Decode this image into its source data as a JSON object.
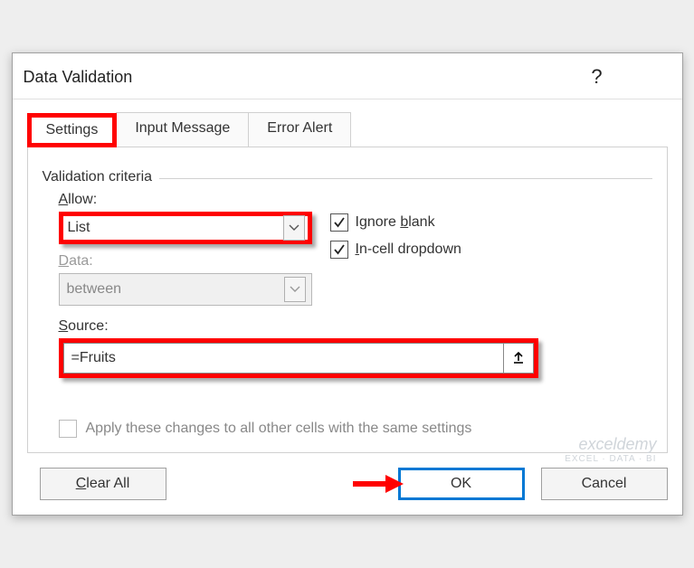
{
  "dialog": {
    "title": "Data Validation"
  },
  "tabs": {
    "settings": "Settings",
    "input_message": "Input Message",
    "error_alert": "Error Alert"
  },
  "criteria": {
    "legend": "Validation criteria",
    "allow_label": "Allow:",
    "allow_value": "List",
    "data_label": "Data:",
    "data_value": "between",
    "ignore_blank_label": "Ignore blank",
    "incell_dropdown_label": "In-cell dropdown",
    "source_label": "Source:",
    "source_value": "=Fruits"
  },
  "apply_changes_label": "Apply these changes to all other cells with the same settings",
  "buttons": {
    "clear_all": "Clear All",
    "ok": "OK",
    "cancel": "Cancel"
  },
  "watermark": {
    "brand": "exceldemy",
    "sub": "EXCEL · DATA · BI"
  }
}
